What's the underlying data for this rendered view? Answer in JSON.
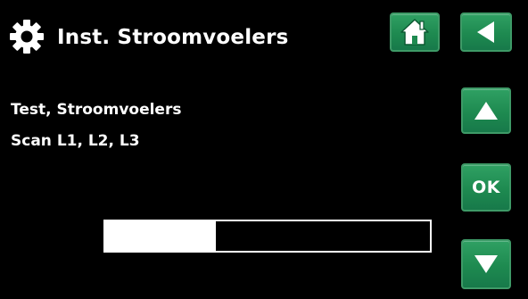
{
  "header": {
    "title": "Inst. Stroomvoelers",
    "icon": "gear-icon"
  },
  "message": {
    "line1": "Test, Stroomvoelers",
    "line2": "Scan L1, L2, L3"
  },
  "progress": {
    "fraction": 0.34
  },
  "buttons": {
    "home_icon": "home-icon",
    "back_icon": "back-arrow-icon",
    "up_icon": "arrow-up-icon",
    "ok_label": "OK",
    "down_icon": "arrow-down-icon"
  },
  "colors": {
    "background": "#000000",
    "text": "#ffffff",
    "button_green": "#1e8a50",
    "button_border": "#3e9a67"
  }
}
